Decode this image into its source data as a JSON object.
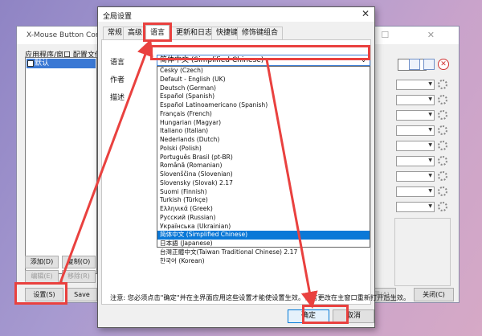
{
  "main_window": {
    "title": "X-Mouse Button Control -",
    "window_controls": "— ☐ ✕",
    "app_list_label": "应用程序/窗口 配置文件",
    "app_item": "默认",
    "buttons": {
      "add": "添加(D)",
      "copy": "复制(O)",
      "edit": "编辑(E)",
      "remove": "移除(R)",
      "settings": "设置(S)",
      "save": "Save",
      "apply": "应用(A)",
      "close": "关闭(C)"
    }
  },
  "dialog": {
    "title": "全局设置",
    "close": "✕",
    "tabs": [
      "常规",
      "高级",
      "语言",
      "更新和日志",
      "快捷键",
      "修饰键组合"
    ],
    "active_tab": "语言",
    "labels": {
      "language": "语言",
      "author": "作者",
      "description": "描述"
    },
    "selected_language": "简体中文 (Simplified Chinese)",
    "languages": [
      "Česky (Czech)",
      "Default - English (UK)",
      "Deutsch (German)",
      "Español (Spanish)",
      "Español Latinoamericano (Spanish)",
      "Français (French)",
      "Hungarian (Magyar)",
      "Italiano (Italian)",
      "Nederlands (Dutch)",
      "Polski (Polish)",
      "Português Brasil (pt-BR)",
      "Română (Romanian)",
      "Slovenščina (Slovenian)",
      "Slovensky (Slovak) 2.17",
      "Suomi (Finnish)",
      "Turkish (Türkçe)",
      "Ελληνικά (Greek)",
      "Русский (Russian)",
      "Українська (Ukrainian)",
      "简体中文 (Simplified Chinese)",
      "日本語 (Japanese)",
      "台灣正體中文(Taiwan Traditional Chinese) 2.17",
      "한국어 (Korean)"
    ],
    "highlighted_index": 19,
    "note": "注意: 您必须点击\"确定\"并在主界面应用这些设置才能使设置生效。语言更改在主窗口重新打开后生效。",
    "ok": "确定",
    "cancel": "取消"
  },
  "colors": {
    "annotation": "#e9413f",
    "selection": "#0a78d7"
  }
}
